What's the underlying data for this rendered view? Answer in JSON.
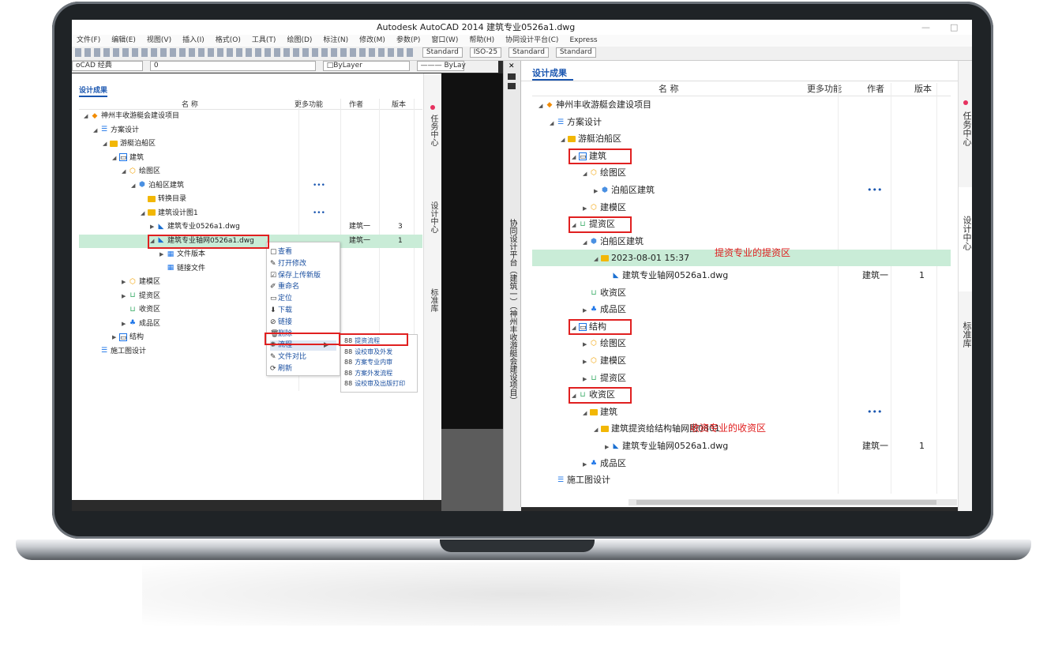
{
  "window": {
    "title": "Autodesk AutoCAD 2014    建筑专业0526a1.dwg",
    "min_glyph": "—",
    "max_glyph": "□"
  },
  "menu": [
    "文件(F)",
    "编辑(E)",
    "视图(V)",
    "插入(I)",
    "格式(O)",
    "工具(T)",
    "绘图(D)",
    "标注(N)",
    "修改(M)",
    "参数(P)",
    "窗口(W)",
    "帮助(H)",
    "协同设计平台(C)",
    "Express"
  ],
  "toolbar": {
    "text_style": "Standard",
    "dim_style": "ISO-25",
    "table_style": "Standard",
    "mleader_style": "Standard",
    "workspace": "oCAD 经典",
    "layer": "0",
    "color": "□ByLayer",
    "linetype": "——— ByLay"
  },
  "left_panel": {
    "tab": "设计成果",
    "headers": {
      "name": "名 称",
      "more": "更多功能",
      "author": "作者",
      "version": "版本"
    },
    "rows": [
      {
        "name": "神州丰收游艇会建设项目",
        "icon": "project-icon",
        "tri": "◢",
        "level": 0
      },
      {
        "name": "方案设计",
        "icon": "scheme-icon",
        "tri": "◢",
        "level": 1
      },
      {
        "name": "游艇泊船区",
        "icon": "folder-icon",
        "tri": "◢",
        "level": 2
      },
      {
        "name": "建筑",
        "icon": "discipline-icon",
        "tri": "◢",
        "level": 3
      },
      {
        "name": "绘图区",
        "icon": "drawing-zone-icon",
        "tri": "◢",
        "level": 4
      },
      {
        "name": "泊船区建筑",
        "icon": "cube-icon",
        "tri": "◢",
        "level": 5,
        "more": "•••"
      },
      {
        "name": "转换目录",
        "icon": "folder-icon",
        "tri": "",
        "level": 6
      },
      {
        "name": "建筑设计图1",
        "icon": "folder-icon",
        "tri": "◢",
        "level": 6,
        "more": "•••"
      },
      {
        "name": "建筑专业0526a1.dwg",
        "icon": "dwg-icon",
        "tri": "▶",
        "level": 7,
        "author": "建筑一",
        "version": "3"
      },
      {
        "name": "建筑专业轴网0526a1.dwg",
        "icon": "dwg-icon",
        "tri": "◢",
        "level": 7,
        "author": "建筑一",
        "version": "1",
        "selected": true
      },
      {
        "name": "文件版本",
        "icon": "version-icon",
        "tri": "▶",
        "level": 8
      },
      {
        "name": "链接文件",
        "icon": "link-file-icon",
        "tri": "",
        "level": 8
      },
      {
        "name": "建模区",
        "icon": "drawing-zone-icon",
        "tri": "▶",
        "level": 4
      },
      {
        "name": "提资区",
        "icon": "outbox-icon",
        "tri": "▶",
        "level": 4
      },
      {
        "name": "收资区",
        "icon": "outbox-icon",
        "tri": "",
        "level": 4
      },
      {
        "name": "成品区",
        "icon": "product-icon",
        "tri": "▶",
        "level": 4
      },
      {
        "name": "结构",
        "icon": "discipline-icon",
        "tri": "▶",
        "level": 3
      },
      {
        "name": "施工图设计",
        "icon": "scheme-icon",
        "tri": "",
        "level": 1
      }
    ]
  },
  "context_menu": {
    "items": [
      {
        "icon": "▢",
        "label": "查看"
      },
      {
        "icon": "✎",
        "label": "打开修改"
      },
      {
        "icon": "☑",
        "label": "保存上传新版"
      },
      {
        "icon": "✐",
        "label": "重命名"
      },
      {
        "icon": "▭",
        "label": "定位"
      },
      {
        "icon": "⬇",
        "label": "下载"
      },
      {
        "icon": "⊘",
        "label": "链接"
      },
      {
        "icon": "🗑",
        "label": "删除"
      },
      {
        "icon": "✺",
        "label": "流程",
        "arrow": "▶"
      },
      {
        "icon": "✎",
        "label": "文件对比"
      },
      {
        "icon": "⟳",
        "label": "刷新"
      }
    ],
    "submenu": [
      "提资流程",
      "设校审及外发",
      "方案专业内审",
      "方案外发流程",
      "设校审及出版打印"
    ],
    "sub_glyph": "88"
  },
  "left_vtabs": [
    "任务中心",
    "设计中心",
    "标准库"
  ],
  "side_strip": {
    "text_a": "协同设计平台（建筑一）（神州丰收游艇会建设项目）",
    "text_b": "（神州丰收游艇会建设项目）",
    "close_glyph": "✕"
  },
  "right_panel": {
    "tab": "设计成果",
    "headers": {
      "name": "名 称",
      "more": "更多功能",
      "author": "作者",
      "version": "版本"
    },
    "rows": [
      {
        "name": "神州丰收游艇会建设项目",
        "icon": "project-icon",
        "tri": "◢",
        "level": 0
      },
      {
        "name": "方案设计",
        "icon": "scheme-icon",
        "tri": "◢",
        "level": 1
      },
      {
        "name": "游艇泊船区",
        "icon": "folder-icon",
        "tri": "◢",
        "level": 2
      },
      {
        "name": "建筑",
        "icon": "discipline-icon",
        "tri": "◢",
        "level": 3,
        "boxed": true
      },
      {
        "name": "绘图区",
        "icon": "drawing-zone-icon",
        "tri": "◢",
        "level": 4
      },
      {
        "name": "泊船区建筑",
        "icon": "cube-icon",
        "tri": "▶",
        "level": 5,
        "more": "•••"
      },
      {
        "name": "建模区",
        "icon": "drawing-zone-icon",
        "tri": "▶",
        "level": 4
      },
      {
        "name": "提资区",
        "icon": "outbox-icon",
        "tri": "◢",
        "level": 3,
        "boxed": true
      },
      {
        "name": "泊船区建筑",
        "icon": "cube-icon",
        "tri": "◢",
        "level": 4
      },
      {
        "name": "2023-08-01 15:37",
        "icon": "folder-icon",
        "tri": "◢",
        "level": 5,
        "selected": true
      },
      {
        "name": "建筑专业轴网0526a1.dwg",
        "icon": "dwg-icon",
        "tri": "",
        "level": 6,
        "author": "建筑一",
        "version": "1"
      },
      {
        "name": "收资区",
        "icon": "outbox-icon",
        "tri": "",
        "level": 4
      },
      {
        "name": "成品区",
        "icon": "product-icon",
        "tri": "▶",
        "level": 4
      },
      {
        "name": "结构",
        "icon": "discipline-icon",
        "tri": "◢",
        "level": 3,
        "boxed": true
      },
      {
        "name": "绘图区",
        "icon": "drawing-zone-icon",
        "tri": "▶",
        "level": 4
      },
      {
        "name": "建模区",
        "icon": "drawing-zone-icon",
        "tri": "▶",
        "level": 4
      },
      {
        "name": "提资区",
        "icon": "outbox-icon",
        "tri": "▶",
        "level": 4
      },
      {
        "name": "收资区",
        "icon": "outbox-icon",
        "tri": "◢",
        "level": 3,
        "boxed": true
      },
      {
        "name": "建筑",
        "icon": "folder-icon",
        "tri": "◢",
        "level": 4,
        "more": "•••"
      },
      {
        "name": "建筑提资给结构轴网图0801",
        "icon": "folder-icon",
        "tri": "◢",
        "level": 5
      },
      {
        "name": "建筑专业轴网0526a1.dwg",
        "icon": "dwg-icon",
        "tri": "▶",
        "level": 6,
        "author": "建筑一",
        "version": "1"
      },
      {
        "name": "成品区",
        "icon": "product-icon",
        "tri": "▶",
        "level": 4
      },
      {
        "name": "施工图设计",
        "icon": "scheme-icon",
        "tri": "",
        "level": 1
      }
    ],
    "annotations": [
      "提资专业的提资区",
      "收资专业的收资区"
    ]
  },
  "right_vtabs": [
    "任务中心",
    "设计中心",
    "标准库"
  ],
  "colors": {
    "accent": "#1a56b0",
    "selected_row": "#c9ecd7",
    "annotation_red": "#e02020",
    "task_dot": "#e6315f"
  }
}
